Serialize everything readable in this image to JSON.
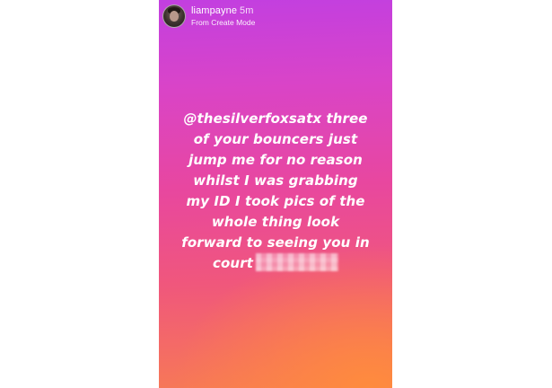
{
  "story": {
    "username": "liampayne",
    "time": "5m",
    "subtitle": "From Create Mode",
    "message_lines": [
      "@thesilverfoxsatx three",
      "of your bouncers just",
      "jump me for no reason",
      "whilst I was grabbing",
      "my ID I took pics of the",
      "whole thing look",
      "forward to seeing you in",
      "court"
    ]
  },
  "colors": {
    "gradient_top": "#c23fe0",
    "gradient_mid": "#e8479f",
    "gradient_bottom": "#f77a55",
    "text": "#ffffff"
  }
}
